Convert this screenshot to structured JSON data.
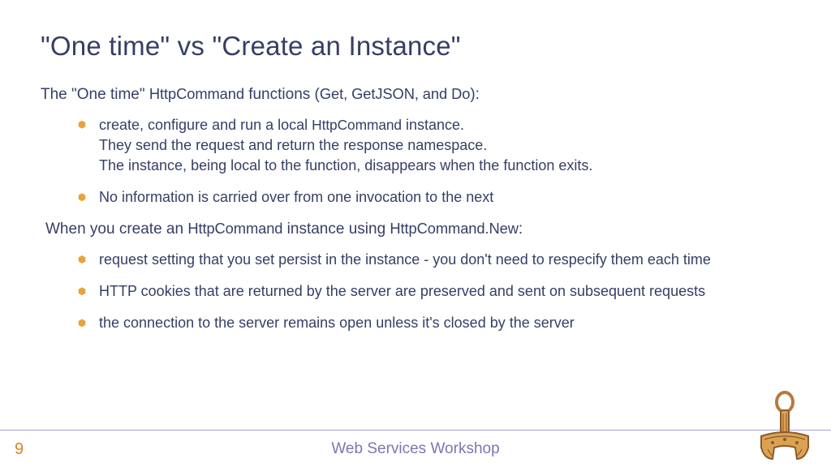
{
  "title": "\"One time\" vs \"Create an Instance\"",
  "section1": {
    "intro_pre": "The \"One time\" ",
    "intro_code": "HttpCommand",
    "intro_mid": " functions (",
    "intro_funcs": "Get, GetJSON, and Do",
    "intro_post": "):",
    "bullets": [
      {
        "line1_pre": "create, configure and run a local ",
        "line1_code": "HttpCommand",
        "line1_post": " instance.",
        "line2": "They send the request and return the response namespace.",
        "line3": "The instance, being local to the function, disappears when the function exits."
      },
      {
        "text": "No information is carried over from one invocation to the next"
      }
    ]
  },
  "section2": {
    "intro_pre": "When you create an ",
    "intro_code1": "HttpCommand",
    "intro_mid": " instance using ",
    "intro_code2": "HttpCommand.New",
    "intro_post": ":",
    "bullets": [
      {
        "text": "request setting that you set persist in the instance - you don't need to respecify them each time"
      },
      {
        "text": "HTTP cookies that are returned by the server are preserved and sent on subsequent requests"
      },
      {
        "text": "the connection to the server remains open unless it's closed by the server"
      }
    ]
  },
  "footer": {
    "page": "9",
    "title": "Web Services Workshop"
  }
}
